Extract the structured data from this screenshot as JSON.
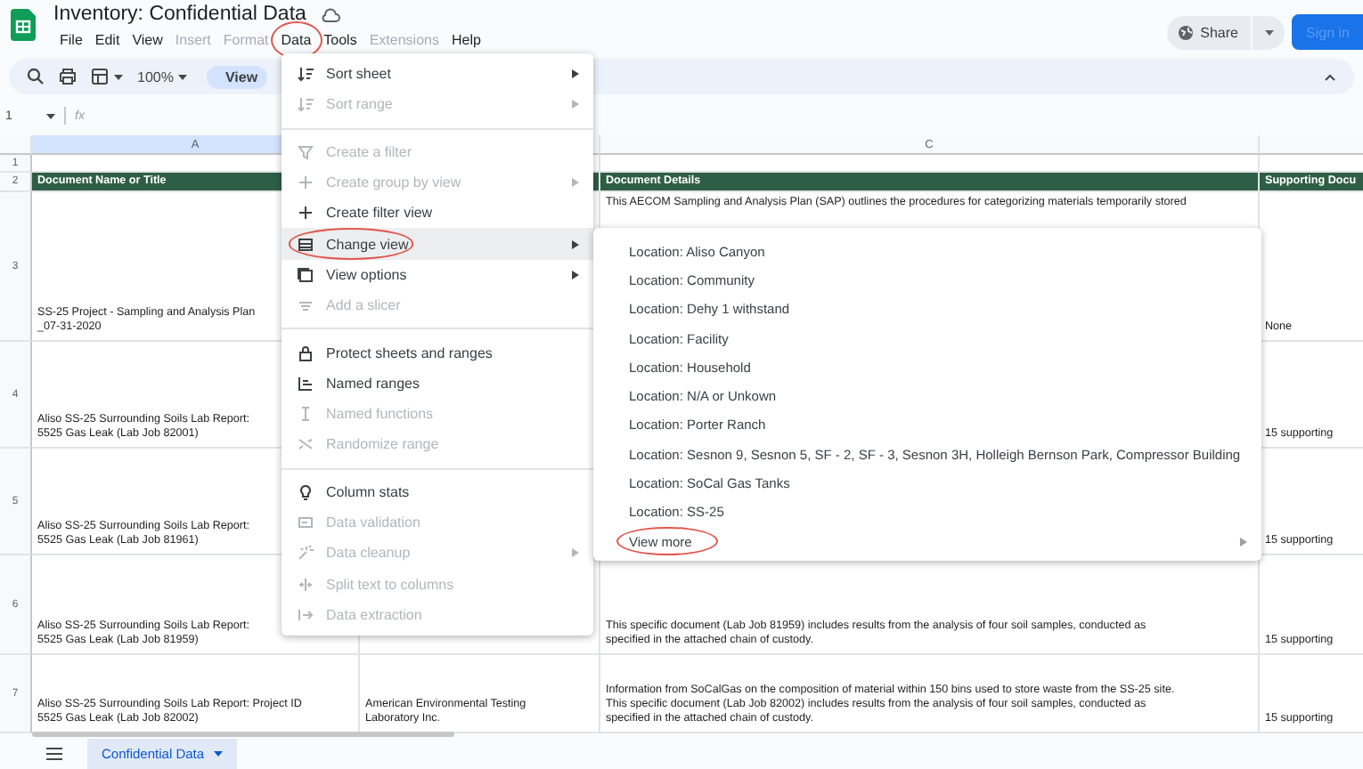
{
  "app": {
    "title": "Inventory: Confidential Data"
  },
  "menubar": [
    {
      "label": "File",
      "disabled": false,
      "circled": false
    },
    {
      "label": "Edit",
      "disabled": false,
      "circled": false
    },
    {
      "label": "View",
      "disabled": false,
      "circled": false
    },
    {
      "label": "Insert",
      "disabled": true,
      "circled": false
    },
    {
      "label": "Format",
      "disabled": true,
      "circled": false
    },
    {
      "label": "Data",
      "disabled": false,
      "circled": true
    },
    {
      "label": "Tools",
      "disabled": false,
      "circled": false
    },
    {
      "label": "Extensions",
      "disabled": true,
      "circled": false
    },
    {
      "label": "Help",
      "disabled": false,
      "circled": false
    }
  ],
  "share": {
    "label": "Share"
  },
  "sign_in": {
    "label": "Sign in"
  },
  "toolbar": {
    "zoom": "100%",
    "view": "View"
  },
  "formula_bar": {
    "cell": "1",
    "fx": "fx"
  },
  "columns": [
    {
      "label": "A"
    },
    {},
    {
      "label": "C"
    },
    {}
  ],
  "rows": [
    {
      "number": "1",
      "kind": "blank",
      "cells": [
        null,
        null,
        null,
        null
      ]
    },
    {
      "number": "2",
      "kind": "header",
      "cells": [
        "Document Name or Title",
        null,
        "Document Details",
        "Supporting Docu"
      ]
    },
    {
      "number": "3",
      "kind": "data",
      "cells": [
        "SS-25 Project - Sampling and Analysis Plan\n_07-31-2020",
        null,
        "This AECOM Sampling and Analysis Plan (SAP) outlines the procedures for categorizing materials temporarily stored",
        "None"
      ]
    },
    {
      "number": "4",
      "kind": "data",
      "cells": [
        "Aliso SS-25 Surrounding Soils Lab Report:\n5525 Gas Leak (Lab Job 82001)",
        null,
        null,
        "15 supporting"
      ]
    },
    {
      "number": "5",
      "kind": "data",
      "cells": [
        "Aliso SS-25 Surrounding Soils Lab Report:\n5525 Gas Leak (Lab Job 81961)",
        null,
        null,
        "15 supporting"
      ]
    },
    {
      "number": "6",
      "kind": "data",
      "cells": [
        "Aliso SS-25 Surrounding Soils Lab Report:\n5525 Gas Leak (Lab Job 81959)",
        null,
        "This specific document (Lab Job 81959) includes results from the analysis of four soil samples, conducted as\nspecified in the attached chain of custody.",
        "15 supporting"
      ]
    },
    {
      "number": "7",
      "kind": "data",
      "cells": [
        "Aliso SS-25 Surrounding Soils Lab Report: Project ID\n5525 Gas Leak (Lab Job 82002)",
        "American Environmental Testing\nLaboratory Inc.",
        "Information from SoCalGas on the composition of material within 150 bins used to store waste from the SS-25 site.\nThis specific document (Lab Job 82002) includes results from the analysis of four soil samples, conducted as\nspecified in the attached chain of custody.",
        "15 supporting"
      ]
    }
  ],
  "data_menu": {
    "items": [
      {
        "kind": "item",
        "label": "Sort sheet",
        "disabled": false,
        "submenu": true,
        "selected": false,
        "circled": false
      },
      {
        "kind": "item",
        "label": "Sort range",
        "disabled": true,
        "submenu": true,
        "selected": false,
        "circled": false
      },
      {
        "kind": "divider"
      },
      {
        "kind": "item",
        "label": "Create a filter",
        "disabled": true,
        "submenu": false,
        "selected": false,
        "circled": false
      },
      {
        "kind": "item",
        "label": "Create group by view",
        "disabled": true,
        "submenu": true,
        "selected": false,
        "circled": false
      },
      {
        "kind": "item",
        "label": "Create filter view",
        "disabled": false,
        "submenu": false,
        "selected": false,
        "circled": false
      },
      {
        "kind": "item",
        "label": "Change view",
        "disabled": false,
        "submenu": true,
        "selected": true,
        "circled": true
      },
      {
        "kind": "item",
        "label": "View options",
        "disabled": false,
        "submenu": true,
        "selected": false,
        "circled": false
      },
      {
        "kind": "item",
        "label": "Add a slicer",
        "disabled": true,
        "submenu": false,
        "selected": false,
        "circled": false
      },
      {
        "kind": "divider"
      },
      {
        "kind": "item",
        "label": "Protect sheets and ranges",
        "disabled": false,
        "submenu": false,
        "selected": false,
        "circled": false
      },
      {
        "kind": "item",
        "label": "Named ranges",
        "disabled": false,
        "submenu": false,
        "selected": false,
        "circled": false
      },
      {
        "kind": "item",
        "label": "Named functions",
        "disabled": true,
        "submenu": false,
        "selected": false,
        "circled": false
      },
      {
        "kind": "item",
        "label": "Randomize range",
        "disabled": true,
        "submenu": false,
        "selected": false,
        "circled": false
      },
      {
        "kind": "divider"
      },
      {
        "kind": "item",
        "label": "Column stats",
        "disabled": false,
        "submenu": false,
        "selected": false,
        "circled": false
      },
      {
        "kind": "item",
        "label": "Data validation",
        "disabled": true,
        "submenu": false,
        "selected": false,
        "circled": false
      },
      {
        "kind": "item",
        "label": "Data cleanup",
        "disabled": true,
        "submenu": true,
        "selected": false,
        "circled": false
      },
      {
        "kind": "item",
        "label": "Split text to columns",
        "disabled": true,
        "submenu": false,
        "selected": false,
        "circled": false
      },
      {
        "kind": "item",
        "label": "Data extraction",
        "disabled": true,
        "submenu": false,
        "selected": false,
        "circled": false
      }
    ]
  },
  "view_submenu": {
    "items": [
      {
        "label": "Location: Aliso Canyon",
        "submenu": false,
        "circled": false
      },
      {
        "label": "Location: Community",
        "submenu": false,
        "circled": false
      },
      {
        "label": "Location: Dehy 1 withstand",
        "submenu": false,
        "circled": false
      },
      {
        "label": "Location: Facility",
        "submenu": false,
        "circled": false
      },
      {
        "label": "Location: Household",
        "submenu": false,
        "circled": false
      },
      {
        "label": "Location: N/A or Unkown",
        "submenu": false,
        "circled": false
      },
      {
        "label": "Location: Porter Ranch",
        "submenu": false,
        "circled": false
      },
      {
        "label": "Location: Sesnon 9, Sesnon 5, SF - 2, SF - 3, Sesnon 3H, Holleigh Bernson Park, Compressor Building",
        "submenu": false,
        "circled": false
      },
      {
        "label": "Location: SoCal Gas Tanks",
        "submenu": false,
        "circled": false
      },
      {
        "label": "Location: SS-25",
        "submenu": false,
        "circled": false
      },
      {
        "label": "View more",
        "submenu": true,
        "circled": true
      }
    ]
  },
  "sheet_tabs": [
    {
      "label": "Confidential Data",
      "selected": true
    }
  ]
}
